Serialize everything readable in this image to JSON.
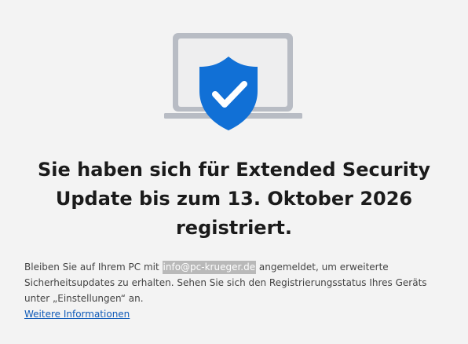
{
  "hero": {
    "illustration_icon": "laptop-shield-checkmark-icon",
    "colors": {
      "laptop_frame": "#b8bcc4",
      "laptop_screen": "#eeeeef",
      "shield": "#1170d6",
      "check": "#ffffff"
    }
  },
  "headline": "Sie haben sich für Extended Security Update bis zum 13. Oktober 2026 registriert.",
  "body": {
    "part1": "Bleiben Sie auf Ihrem PC mit ",
    "account": "info@pc-krueger.de",
    "part2": " angemeldet, um erweiterte Sicherheitsupdates zu erhalten. Sehen Sie sich den Registrierungsstatus Ihres Geräts unter „Einstellungen“ an."
  },
  "link": {
    "label": "Weitere Informationen",
    "color": "#0f5ab8"
  }
}
